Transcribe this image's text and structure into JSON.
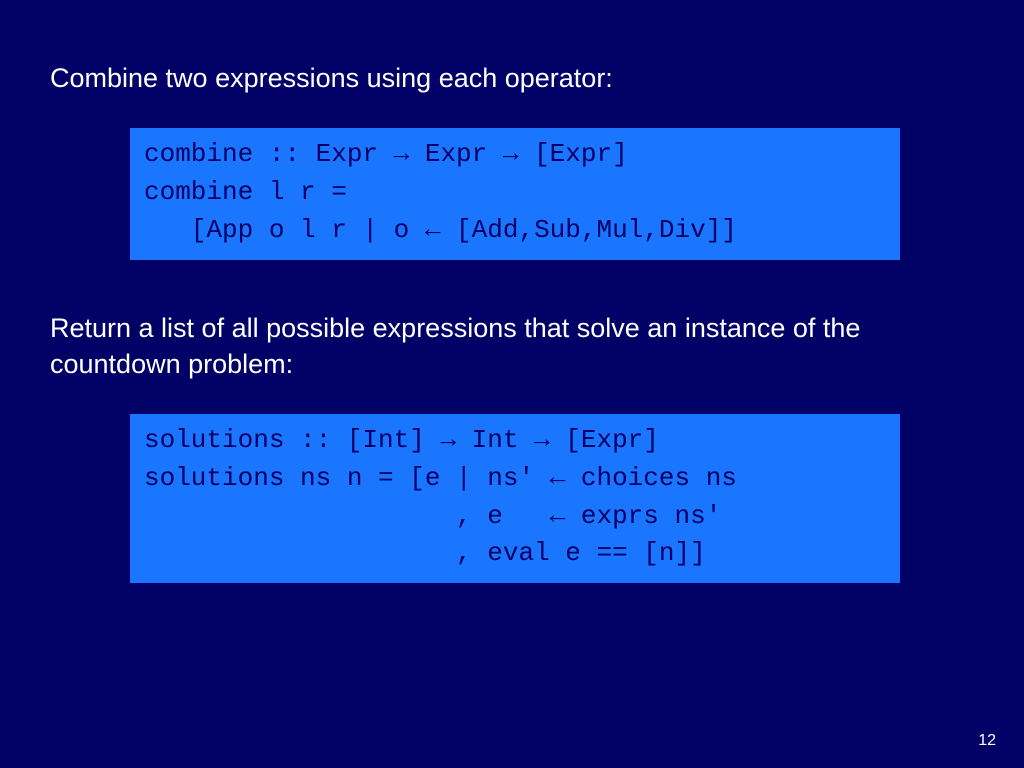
{
  "slide": {
    "text1": "Combine two expressions using each operator:",
    "code1": "combine :: Expr → Expr → [Expr]\ncombine l r =\n   [App o l r | o ← [Add,Sub,Mul,Div]]",
    "text2": "Return a list of all possible expressions that solve an instance of the countdown problem:",
    "code2": "solutions :: [Int] → Int → [Expr]\nsolutions ns n = [e | ns' ← choices ns\n                    , e   ← exprs ns'\n                    , eval e == [n]]",
    "page_number": "12"
  }
}
